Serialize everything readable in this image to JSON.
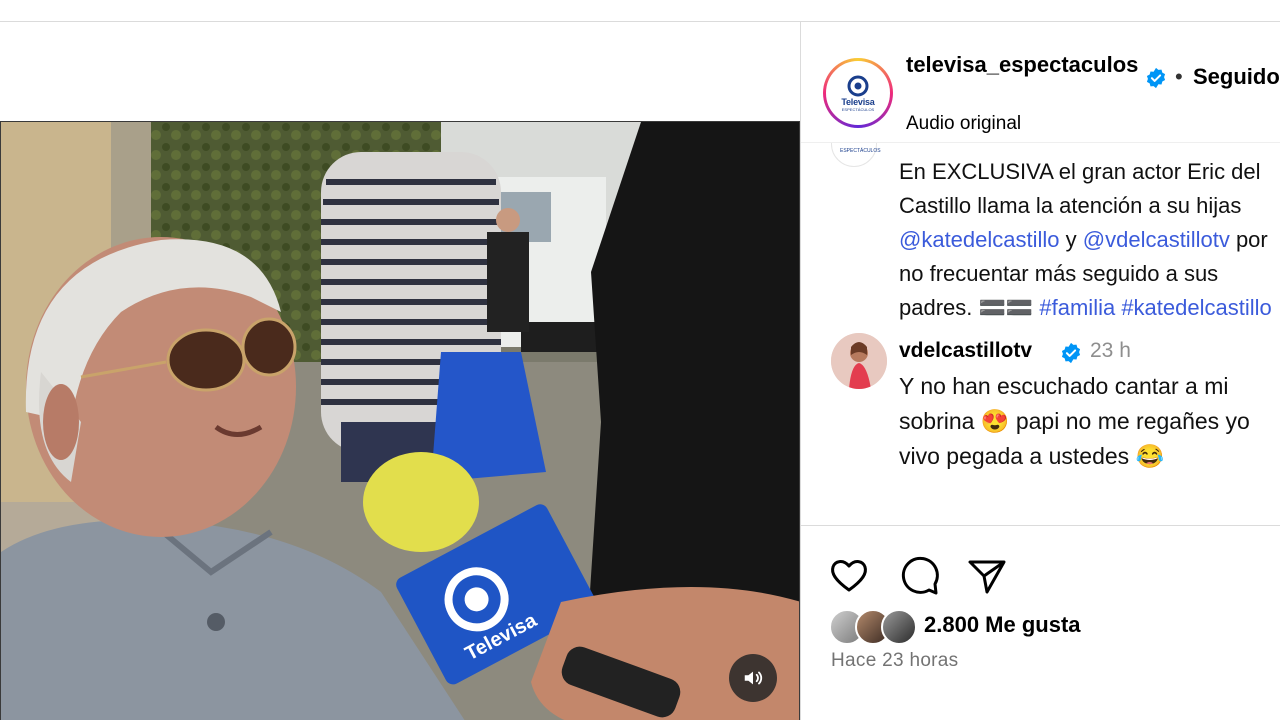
{
  "header": {
    "username": "televisa_espectaculos",
    "follow_state": "Seguido",
    "separator": "•",
    "audio": "Audio original",
    "avatar_logo_word": "Televisa",
    "avatar_logo_sub": "ESPECTÁCULOS"
  },
  "caption": {
    "avatar_logo_sub": "ESPECTÁCULOS",
    "part1": "En EXCLUSIVA el gran actor Eric del Castillo llama la atención a su hijas ",
    "mention1": "@katedelcastillo",
    "connector": " y ",
    "mention2": "@vdelcastillotv",
    "part2": " por no frecuentar más seguido a sus padres. 🟰🟰 ",
    "hashtag1": "#familia",
    "hashtag2": " #katedelcastillo"
  },
  "comment": {
    "username": "vdelcastillotv",
    "time": "23 h",
    "text": "Y no han escuchado cantar a mi sobrina 😍 papi no me regañes yo vivo pegada a ustedes 😂"
  },
  "actions": {
    "likes": "2.800 Me gusta",
    "posted": "Hace 23 horas"
  },
  "video": {
    "mic_brand": "Televisa",
    "muted": false
  },
  "colors": {
    "verified": "#0095f6",
    "link": "#3b5bdb",
    "muted_text": "#737373"
  },
  "icons": [
    "verified-badge-icon",
    "heart-icon",
    "comment-icon",
    "share-icon",
    "speaker-icon"
  ]
}
